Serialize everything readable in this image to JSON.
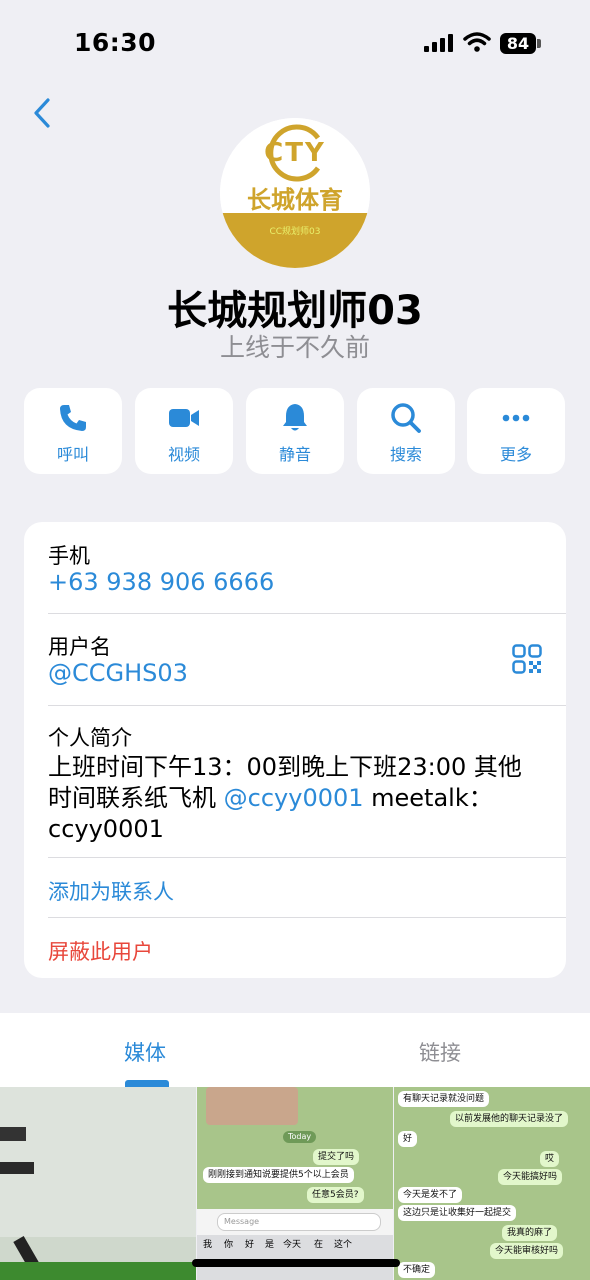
{
  "status_bar": {
    "time": "16:30",
    "battery": "84"
  },
  "profile": {
    "avatar_brand": "CTY",
    "avatar_name": "长城体育",
    "avatar_tag": "CC规划师03",
    "name": "长城规划师03",
    "status": "上线于不久前"
  },
  "actions": [
    {
      "label": "呼叫",
      "icon": "phone-icon"
    },
    {
      "label": "视频",
      "icon": "video-icon"
    },
    {
      "label": "静音",
      "icon": "bell-icon"
    },
    {
      "label": "搜索",
      "icon": "search-icon"
    },
    {
      "label": "更多",
      "icon": "more-icon"
    }
  ],
  "info": {
    "phone_label": "手机",
    "phone_value": "+63 938 906 6666",
    "username_label": "用户名",
    "username_value": "@CCGHS03",
    "bio_label": "个人简介",
    "bio_part1": "上班时间下午13：00到晚上下班23:00 其他时间联系纸飞机 ",
    "bio_handle": "@ccyy0001",
    "bio_part2": " meetalk：ccyy0001",
    "add_contact": "添加为联系人",
    "block_user": "屏蔽此用户"
  },
  "tabs": {
    "media": "媒体",
    "links": "链接"
  },
  "thumb2": {
    "today": "Today",
    "msg1": "提交了吗",
    "msg2": "刚刚接到通知说要提供5个以上会员",
    "msg3": "任意5会员?",
    "input_placeholder": "Message",
    "keys": [
      "我",
      "你",
      "好",
      "是",
      "今天",
      "在",
      "这个"
    ]
  },
  "thumb3": {
    "msgs": [
      "有聊天记录就没问题",
      "以前发展他的聊天记录没了",
      "好",
      "哎",
      "今天能搞好吗",
      "今天是发不了",
      "这边只是让收集好一起提交",
      "我真的麻了",
      "今天能审核好吗",
      "不确定"
    ]
  },
  "colors": {
    "accent": "#2b8ad8",
    "danger": "#e8473b",
    "brand_gold": "#cfa42c"
  }
}
